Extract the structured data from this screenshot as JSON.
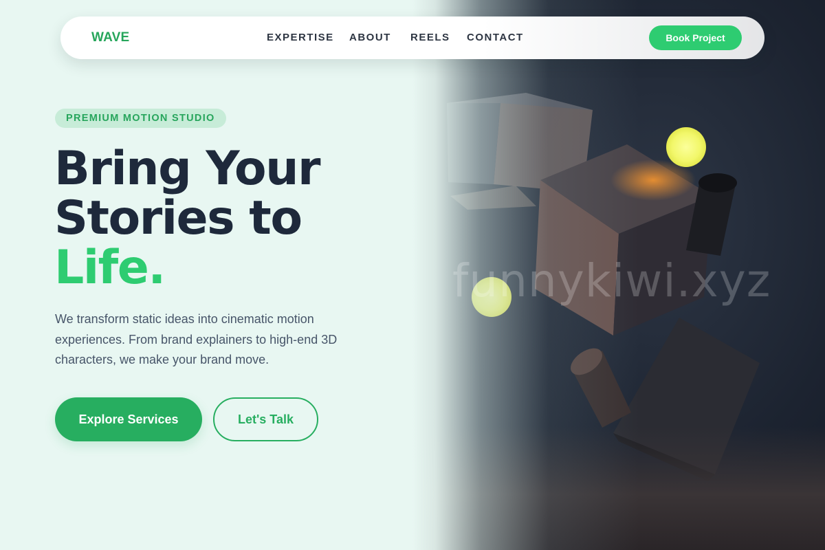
{
  "brand": {
    "logo_text": "WAVE",
    "accent": "#2ecc71",
    "accent_dark": "#27ae60",
    "heading_color": "#1e293b"
  },
  "nav": {
    "links": [
      {
        "label": "EXPERTISE"
      },
      {
        "label": "ABOUT"
      },
      {
        "label": "REELS"
      },
      {
        "label": "CONTACT"
      }
    ],
    "cta_label": "Book Project"
  },
  "hero": {
    "badge": "PREMIUM MOTION STUDIO",
    "headline_line1": "Bring Your",
    "headline_line2": "Stories to",
    "headline_accent": "Life.",
    "description": "We transform static ideas into cinematic motion experiences. From brand explainers to high-end 3D characters, we make your brand move.",
    "primary_button": "Explore Services",
    "secondary_button": "Let's Talk"
  },
  "visual": {
    "watermark": "funnykiwi.xyz",
    "icons": [
      "floating-cube",
      "glowing-orb",
      "cylinder"
    ]
  }
}
